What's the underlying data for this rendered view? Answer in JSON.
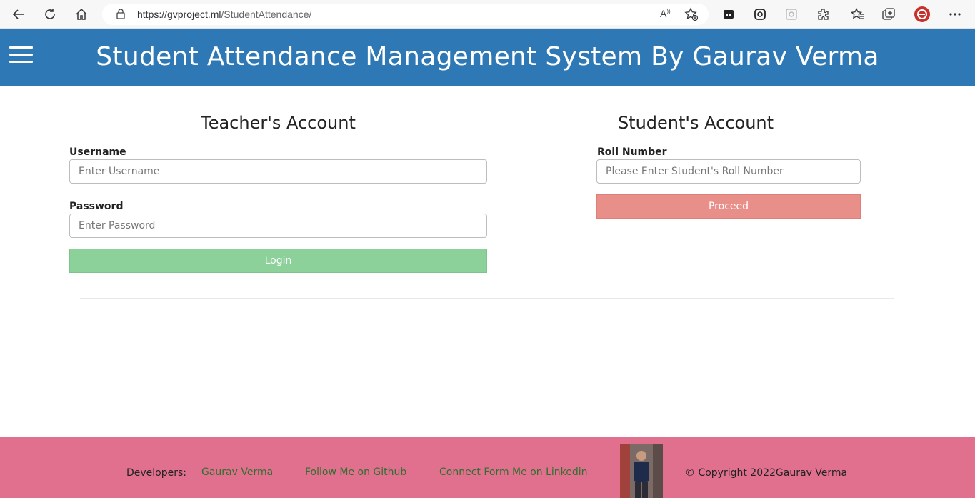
{
  "browser": {
    "url_host": "https://gvproject.ml",
    "url_path": "/StudentAttendance/",
    "read_aloud": "A",
    "icons": [
      "back-icon",
      "refresh-icon",
      "home-icon",
      "lock-icon",
      "read-aloud-icon",
      "favorite-add-icon",
      "tab-actions-icon",
      "sync-icon",
      "extension-puzzle-gray-icon",
      "extensions-icon",
      "favorites-icon",
      "collections-icon",
      "profile-avatar-icon",
      "more-menu-icon"
    ]
  },
  "header": {
    "title": "Student Attendance Management System By Gaurav Verma",
    "bg_color": "#2e79b5"
  },
  "teacher": {
    "heading": "Teacher's Account",
    "username_label": "Username",
    "username_placeholder": "Enter Username",
    "password_label": "Password",
    "password_placeholder": "Enter Password",
    "login_label": "Login",
    "login_color": "#8cd19a"
  },
  "student": {
    "heading": "Student's Account",
    "roll_label": "Roll Number",
    "roll_placeholder": "Please Enter Student's Roll Number",
    "proceed_label": "Proceed",
    "proceed_color": "#e88f8a"
  },
  "footer": {
    "developers_label": "Developers:",
    "link_name": "Gaurav Verma",
    "link_github": "Follow Me on Github",
    "link_linkedin": "Connect Form Me on Linkedin",
    "copyright": "© Copyright 2022Gaurav Verma",
    "bg_color": "#e0708e"
  }
}
